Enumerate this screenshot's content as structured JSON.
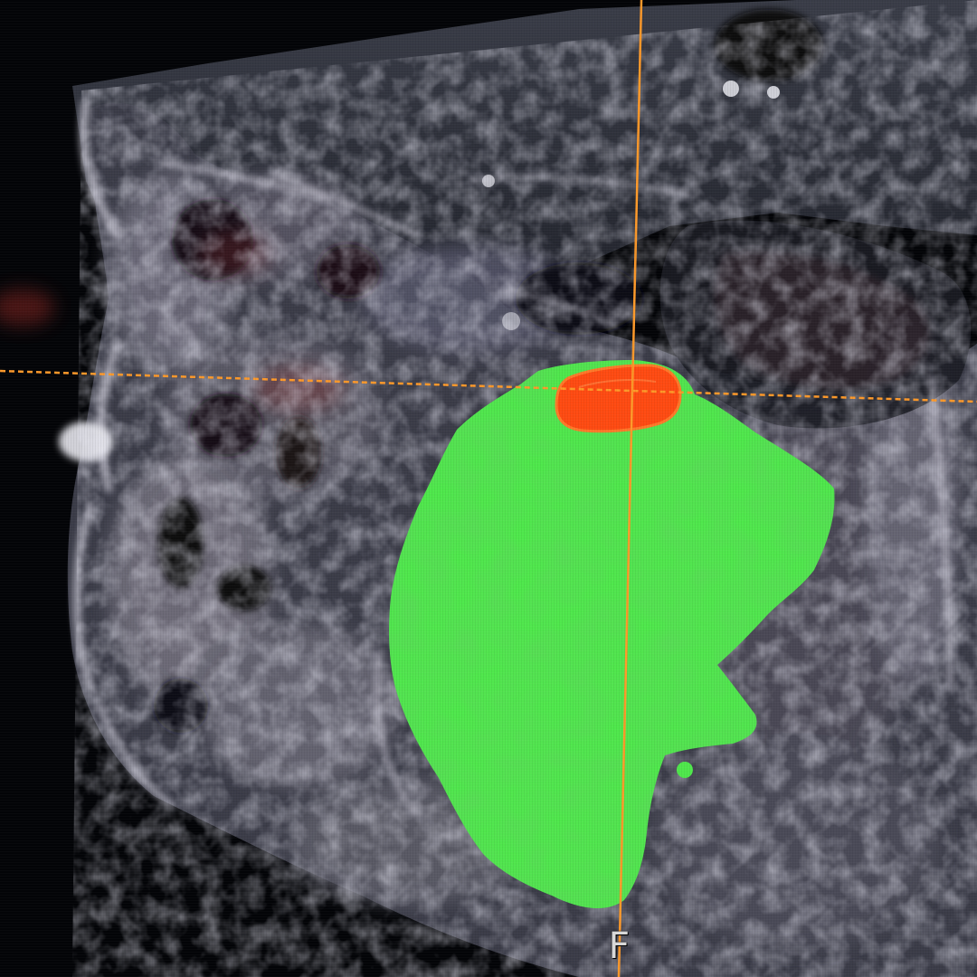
{
  "viewer": {
    "orientation_label": "F"
  },
  "segments": [
    {
      "name": "green-segment",
      "color": "#4fe84c"
    },
    {
      "name": "red-segment",
      "color": "#ff4b12"
    }
  ],
  "crosshair": {
    "color": "#ff9a2a"
  }
}
